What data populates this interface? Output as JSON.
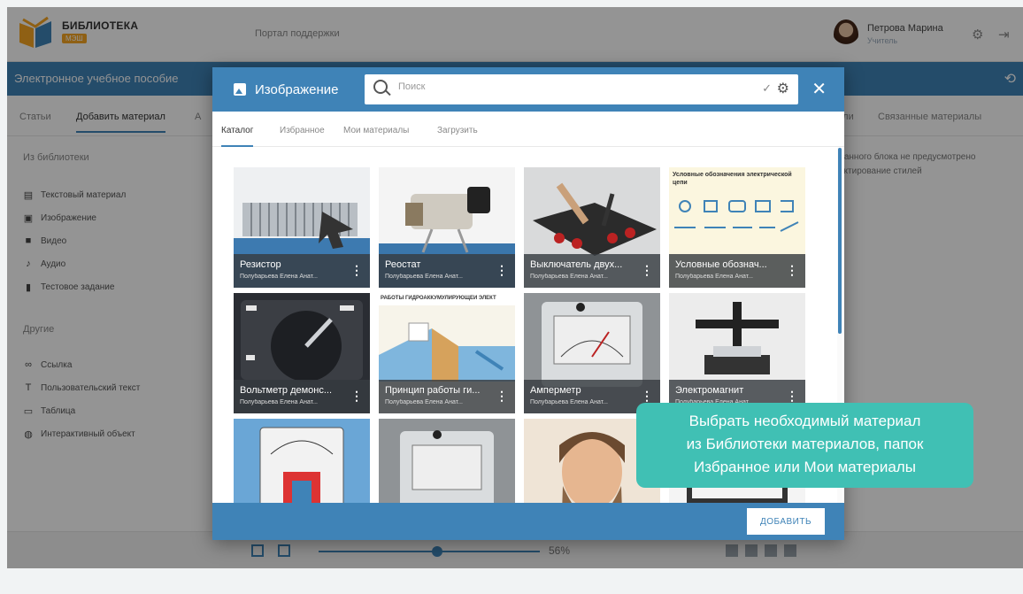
{
  "header": {
    "logo_text": "БИБЛИОТЕКА",
    "logo_badge": "МЭШ",
    "portal_link": "Портал поддержки",
    "user_name": "Петрова Марина",
    "user_role": "Учитель"
  },
  "bluebar": {
    "title": "Электронное учебное пособие"
  },
  "left_tabs": [
    {
      "label": "Статьи"
    },
    {
      "label": "Добавить материал"
    },
    {
      "label": "А"
    }
  ],
  "right_tabs": [
    {
      "label": "или"
    },
    {
      "label": "Связанные материалы"
    }
  ],
  "left_panel": {
    "library_section": "Из библиотеки",
    "library_items": [
      {
        "label": "Текстовый материал",
        "icon": "text-doc-icon"
      },
      {
        "label": "Изображение",
        "icon": "image-icon"
      },
      {
        "label": "Видео",
        "icon": "video-icon"
      },
      {
        "label": "Аудио",
        "icon": "music-note-icon"
      },
      {
        "label": "Тестовое задание",
        "icon": "test-doc-icon"
      }
    ],
    "other_section": "Другие",
    "other_items": [
      {
        "label": "Ссылка",
        "icon": "link-icon"
      },
      {
        "label": "Пользовательский текст",
        "icon": "text-format-icon"
      },
      {
        "label": "Таблица",
        "icon": "table-icon"
      },
      {
        "label": "Интерактивный объект",
        "icon": "interactive-icon"
      }
    ]
  },
  "right_info": {
    "line1": "данного блока не предусмотрено",
    "line2": "актирование стилей"
  },
  "bottom_toolbar": {
    "zoom": "56%"
  },
  "modal": {
    "title": "Изображение",
    "search_placeholder": "Поиск",
    "tabs": [
      {
        "label": "Каталог"
      },
      {
        "label": "Избранное"
      },
      {
        "label": "Мои материалы"
      },
      {
        "label": "Загрузить"
      }
    ],
    "cards": [
      {
        "title": "Резистор",
        "author": "Полубарьева Елена Анат..."
      },
      {
        "title": "Реостат",
        "author": "Полубарьева Елена Анат..."
      },
      {
        "title": "Выключатель двух...",
        "author": "Полубарьева Елена Анат..."
      },
      {
        "title": "Условные обознач...",
        "author": "Полубарьева Елена Анат...",
        "image_text": "Условные обозначения электрической цепи"
      },
      {
        "title": "Вольтметр демонс...",
        "author": "Полубарьева Елена Анат..."
      },
      {
        "title": "Принцип работы ги...",
        "author": "Полубарьева Елена Анат...",
        "image_text": "РАБОТЫ ГИДРОАККУМУЛИРУЮЩЕЙ ЭЛЕКТ"
      },
      {
        "title": "Амперметр",
        "author": "Полубарьева Елена Анат..."
      },
      {
        "title": "Электромагнит",
        "author": "Полубарьева Елена Анат..."
      },
      {
        "title": "",
        "author": ""
      },
      {
        "title": "",
        "author": ""
      },
      {
        "title": "",
        "author": ""
      },
      {
        "title": "",
        "author": ""
      }
    ],
    "add_button": "ДОБАВИТЬ"
  },
  "tooltip": {
    "line1": "Выбрать необходимый материал",
    "line2": "из Библиотеки материалов, папок",
    "line3": "Избранное или Мои материалы"
  },
  "colors": {
    "primary": "#3f83b7",
    "tooltip": "#40c0b4"
  }
}
